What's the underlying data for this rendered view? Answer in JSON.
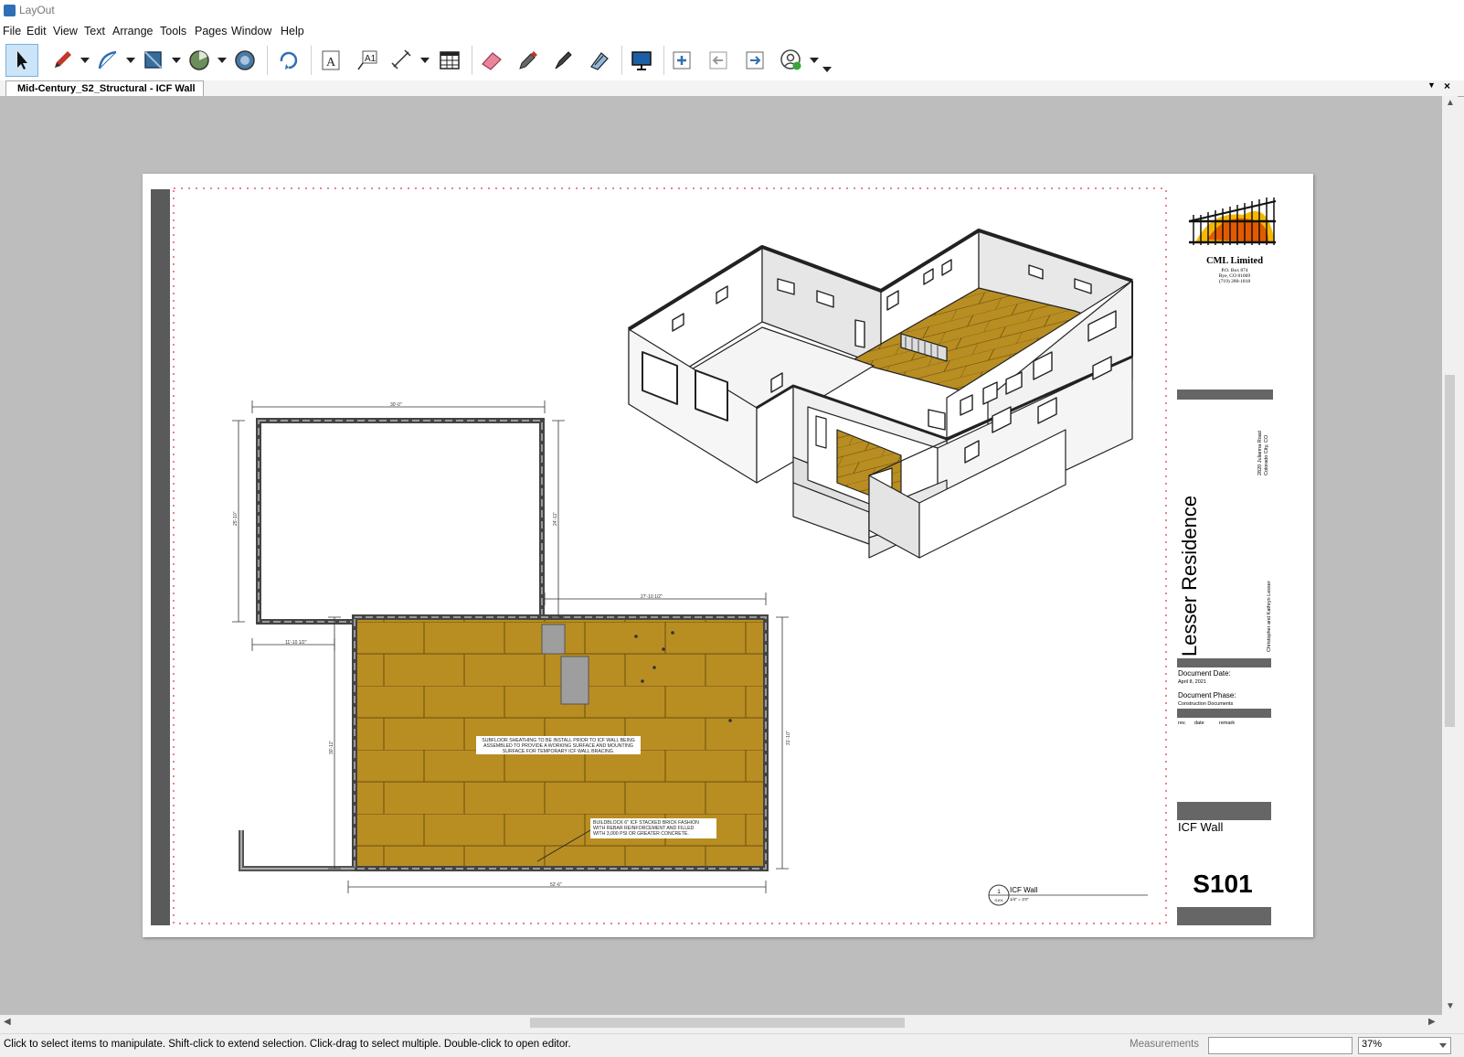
{
  "app": {
    "title": "LayOut"
  },
  "menu": [
    "File",
    "Edit",
    "View",
    "Text",
    "Arrange",
    "Tools",
    "Pages",
    "Window",
    "Help"
  ],
  "toolbar": {
    "tools": [
      "select-tool",
      "pencil-tool",
      "arc-tool",
      "shape-tool",
      "pie-tool",
      "offset-tool",
      "rotate-tool",
      "text-tool",
      "label-tool",
      "dimension-tool",
      "table-tool",
      "eraser-tool",
      "eyedropper-tool",
      "split-tool",
      "join-tool",
      "presentation-tool",
      "add-page-tool",
      "previous-page-tool",
      "next-page-tool",
      "account-tool"
    ]
  },
  "document": {
    "tab_title": "Mid-Century_S2_Structural - ICF Wall"
  },
  "status": {
    "hint": "Click to select items to manipulate. Shift-click to extend selection. Click-drag to select multiple. Double-click to open editor.",
    "measurements_label": "Measurements",
    "measurements_value": "",
    "zoom": "37%"
  },
  "sheet": {
    "company": "CML Limited",
    "company_address": [
      "P.O. Box 874",
      "Rye, CO 81069",
      "(719) 280-1818"
    ],
    "project_title": "Lesser Residence",
    "project_address": [
      "2820 Julianna Road",
      "Colorado City, CO"
    ],
    "clients": "Christopher and Kathryn Lesser",
    "document_date_label": "Document Date:",
    "document_date": "April 8, 2021",
    "document_phase_label": "Document Phase:",
    "document_phase": "Construction Documents",
    "rev_headers": [
      "rev.",
      "date",
      "remark"
    ],
    "sheet_name": "ICF Wall",
    "sheet_number": "S101"
  },
  "plan": {
    "dims": [
      "30'-0\"",
      "25'-10\"",
      "24'-11\"",
      "27'-10 1/2\"",
      "11'-10 1/2\"",
      "30'-11\"",
      "31'-10\"",
      "52'-6\""
    ],
    "note_subfloor": [
      "SUBFLOOR SHEATHING TO BE INSTALL PRIOR TO ICF WALL BEING",
      "ASSEMBLED TO PROVIDE A WORKING SURFACE AND MOUNTING",
      "SURFACE FOR TEMPORARY ICF WALL BRACING."
    ],
    "note_icf": [
      "BUILDBLOCK 6\" ICF STACKED BRICK FASHION",
      "WITH REBAR REINFORCEMENT AND FILLED",
      "WITH 3,000 PSI OR GREATER CONCRETE."
    ],
    "view_tag": {
      "number": "1",
      "sheet": "S101",
      "title": "ICF Wall",
      "scale": "1/4\" = 1'0\""
    }
  },
  "colors": {
    "floor": "#b88d22",
    "floor_line": "#6a4e0c",
    "wall": "#4a4a4a",
    "accent": "#2f6fb5"
  }
}
